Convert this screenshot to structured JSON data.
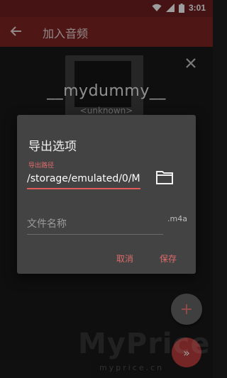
{
  "status_bar": {
    "time": "3:01"
  },
  "app_bar": {
    "title": "加入音频"
  },
  "track": {
    "title": "__mydummy__",
    "artist": "<unknown>"
  },
  "dialog": {
    "title": "导出选项",
    "path_label": "导出路径",
    "path_value": "/storage/emulated/0/M",
    "file_name_placeholder": "文件名称",
    "extension": ".m4a",
    "cancel_label": "取消",
    "save_label": "保存"
  },
  "fab": {
    "add": "+",
    "next": "»"
  },
  "watermark": {
    "main": "MyPrice",
    "sub": "myprice.cn"
  },
  "colors": {
    "accent": "#e05a5a",
    "app_bar": "#7a2222",
    "dialog_bg": "#434343"
  },
  "icons": [
    "wifi-icon",
    "signal-icon",
    "battery-icon",
    "back-arrow-icon",
    "close-icon",
    "folder-icon"
  ]
}
